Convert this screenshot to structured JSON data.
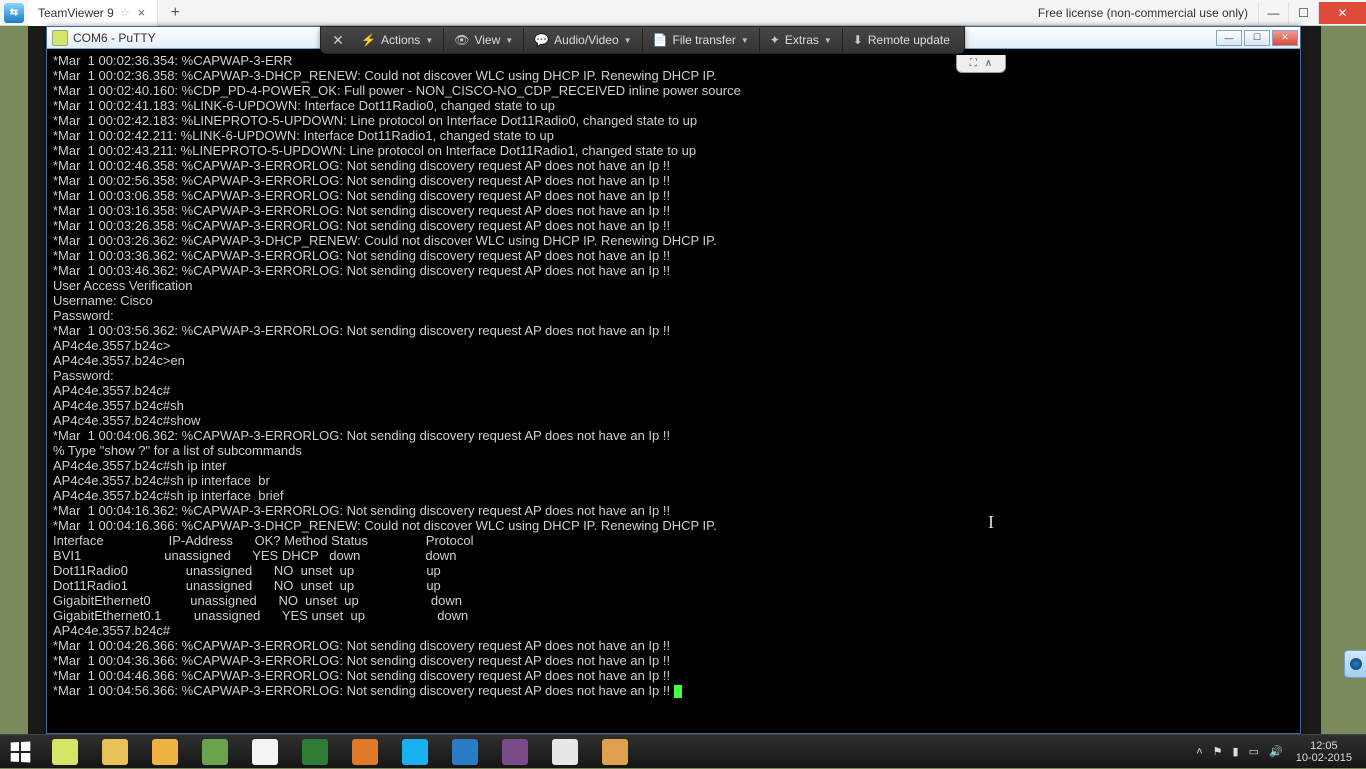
{
  "tv": {
    "tab_title": "TeamViewer 9",
    "license_text": "Free license (non-commercial use only)"
  },
  "session_toolbar": {
    "actions": "Actions",
    "view": "View",
    "audio": "Audio/Video",
    "file": "File transfer",
    "extras": "Extras",
    "remote": "Remote update"
  },
  "putty": {
    "title": "COM6 - PuTTY"
  },
  "terminal_lines": [
    "*Mar  1 00:02:36.354: %CAPWAP-3-ERR                                                                                             ",
    "*Mar  1 00:02:36.358: %CAPWAP-3-DHCP_RENEW: Could not discover WLC using DHCP IP. Renewing DHCP IP.",
    "*Mar  1 00:02:40.160: %CDP_PD-4-POWER_OK: Full power - NON_CISCO-NO_CDP_RECEIVED inline power source",
    "*Mar  1 00:02:41.183: %LINK-6-UPDOWN: Interface Dot11Radio0, changed state to up",
    "*Mar  1 00:02:42.183: %LINEPROTO-5-UPDOWN: Line protocol on Interface Dot11Radio0, changed state to up",
    "*Mar  1 00:02:42.211: %LINK-6-UPDOWN: Interface Dot11Radio1, changed state to up",
    "*Mar  1 00:02:43.211: %LINEPROTO-5-UPDOWN: Line protocol on Interface Dot11Radio1, changed state to up",
    "*Mar  1 00:02:46.358: %CAPWAP-3-ERRORLOG: Not sending discovery request AP does not have an Ip !!",
    "*Mar  1 00:02:56.358: %CAPWAP-3-ERRORLOG: Not sending discovery request AP does not have an Ip !!",
    "*Mar  1 00:03:06.358: %CAPWAP-3-ERRORLOG: Not sending discovery request AP does not have an Ip !!",
    "*Mar  1 00:03:16.358: %CAPWAP-3-ERRORLOG: Not sending discovery request AP does not have an Ip !!",
    "*Mar  1 00:03:26.358: %CAPWAP-3-ERRORLOG: Not sending discovery request AP does not have an Ip !!",
    "*Mar  1 00:03:26.362: %CAPWAP-3-DHCP_RENEW: Could not discover WLC using DHCP IP. Renewing DHCP IP.",
    "*Mar  1 00:03:36.362: %CAPWAP-3-ERRORLOG: Not sending discovery request AP does not have an Ip !!",
    "*Mar  1 00:03:46.362: %CAPWAP-3-ERRORLOG: Not sending discovery request AP does not have an Ip !!",
    "",
    "User Access Verification",
    "",
    "Username: Cisco",
    "Password:",
    "*Mar  1 00:03:56.362: %CAPWAP-3-ERRORLOG: Not sending discovery request AP does not have an Ip !!",
    "",
    "AP4c4e.3557.b24c>",
    "AP4c4e.3557.b24c>en",
    "Password:",
    "AP4c4e.3557.b24c#",
    "AP4c4e.3557.b24c#sh",
    "AP4c4e.3557.b24c#show",
    "*Mar  1 00:04:06.362: %CAPWAP-3-ERRORLOG: Not sending discovery request AP does not have an Ip !!",
    "% Type \"show ?\" for a list of subcommands",
    "AP4c4e.3557.b24c#sh ip inter",
    "AP4c4e.3557.b24c#sh ip interface  br",
    "AP4c4e.3557.b24c#sh ip interface  brief",
    "*Mar  1 00:04:16.362: %CAPWAP-3-ERRORLOG: Not sending discovery request AP does not have an Ip !!",
    "*Mar  1 00:04:16.366: %CAPWAP-3-DHCP_RENEW: Could not discover WLC using DHCP IP. Renewing DHCP IP.",
    "Interface                  IP-Address      OK? Method Status                Protocol",
    "BVI1                       unassigned      YES DHCP   down                  down",
    "Dot11Radio0                unassigned      NO  unset  up                    up",
    "Dot11Radio1                unassigned      NO  unset  up                    up",
    "GigabitEthernet0           unassigned      NO  unset  up                    down",
    "GigabitEthernet0.1         unassigned      YES unset  up                    down",
    "AP4c4e.3557.b24c#",
    "*Mar  1 00:04:26.366: %CAPWAP-3-ERRORLOG: Not sending discovery request AP does not have an Ip !!",
    "*Mar  1 00:04:36.366: %CAPWAP-3-ERRORLOG: Not sending discovery request AP does not have an Ip !!",
    "*Mar  1 00:04:46.366: %CAPWAP-3-ERRORLOG: Not sending discovery request AP does not have an Ip !!",
    "*Mar  1 00:04:56.366: %CAPWAP-3-ERRORLOG: Not sending discovery request AP does not have an Ip !! "
  ],
  "taskbar": {
    "items": [
      "putty",
      "explorer",
      "outlook",
      "winscp",
      "chrome",
      "excel",
      "firefox",
      "skype",
      "teamviewer",
      "winrar",
      "notepad",
      "utility"
    ],
    "colors": [
      "#d7e46a",
      "#e8c158",
      "#f0b342",
      "#6aa34b",
      "#f4f4f4",
      "#2f7d34",
      "#e07a2a",
      "#1bb0ef",
      "#2a7cc4",
      "#7a4a8a",
      "#e7e7e7",
      "#e0a050"
    ]
  },
  "clock": {
    "time": "12:05",
    "date": "10-02-2015"
  }
}
